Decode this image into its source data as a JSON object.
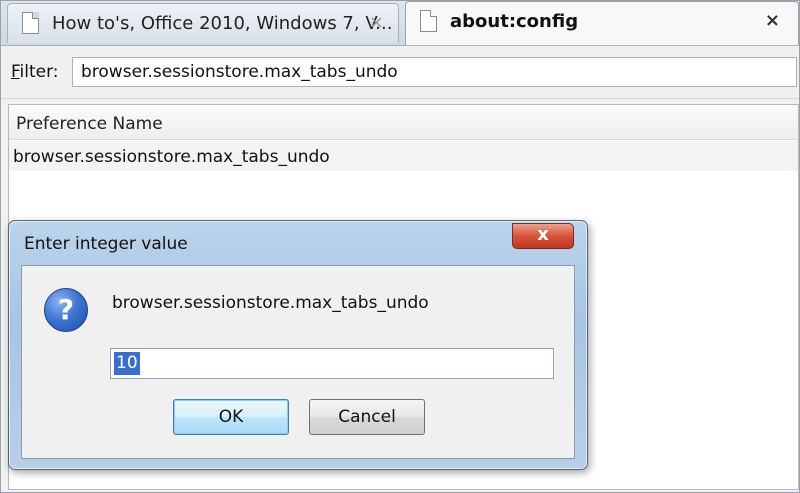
{
  "tabs": [
    {
      "label": "How to's, Office 2010, Windows 7, V...",
      "close_glyph": "×",
      "active": false
    },
    {
      "label": "about:config",
      "close_glyph": "×",
      "active": true
    }
  ],
  "filter": {
    "label_prefix": "F",
    "label_rest": "ilter:",
    "value": "browser.sessionstore.max_tabs_undo"
  },
  "preferences": {
    "column_header": "Preference Name",
    "rows": [
      {
        "name": "browser.sessionstore.max_tabs_undo"
      }
    ]
  },
  "dialog": {
    "title": "Enter integer value",
    "close_glyph": "x",
    "icon": "question-icon",
    "icon_glyph": "?",
    "message": "browser.sessionstore.max_tabs_undo",
    "input_value": "10",
    "ok_label": "OK",
    "cancel_label": "Cancel"
  },
  "colors": {
    "selection": "#3a6fc7",
    "close_button": "#d8533b",
    "dialog_frame": "#a9c4e2"
  }
}
